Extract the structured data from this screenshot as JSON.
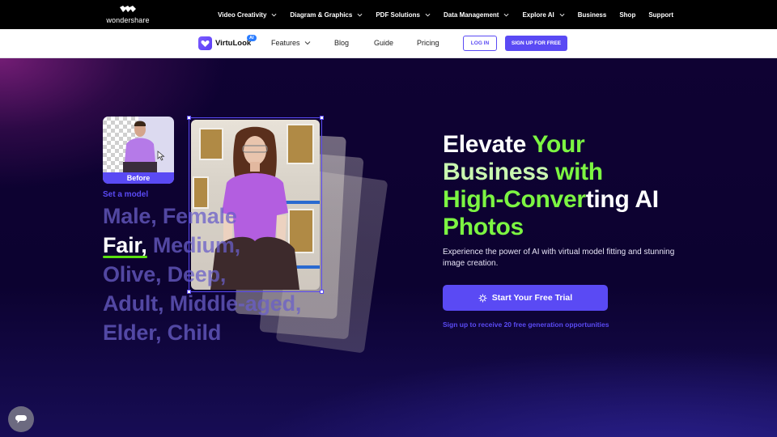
{
  "topbar": {
    "brand": "wondershare",
    "nav": [
      {
        "label": "Video Creativity",
        "has_dropdown": true
      },
      {
        "label": "Diagram & Graphics",
        "has_dropdown": true
      },
      {
        "label": "PDF Solutions",
        "has_dropdown": true
      },
      {
        "label": "Data Management",
        "has_dropdown": true
      },
      {
        "label": "Explore AI",
        "has_dropdown": true
      },
      {
        "label": "Business",
        "has_dropdown": false
      },
      {
        "label": "Shop",
        "has_dropdown": false
      },
      {
        "label": "Support",
        "has_dropdown": false
      }
    ]
  },
  "product_nav": {
    "product_name": "VirtuLook",
    "badge": "AI",
    "items": [
      {
        "label": "Features",
        "has_dropdown": true
      },
      {
        "label": "Blog"
      },
      {
        "label": "Guide"
      },
      {
        "label": "Pricing"
      }
    ],
    "login_label": "LOG IN",
    "signup_label": "SIGN UP FOR FREE"
  },
  "hero": {
    "before_label": "Before",
    "set_model_label": "Set a model",
    "attribute_lines": [
      {
        "parts": [
          {
            "text": "Male, Female",
            "highlight": false
          }
        ]
      },
      {
        "parts": [
          {
            "text": "Fair,",
            "highlight": true
          },
          {
            "text": " Medium,",
            "highlight": false
          }
        ]
      },
      {
        "parts": [
          {
            "text": "Olive, Deep,",
            "highlight": false
          }
        ]
      },
      {
        "parts": [
          {
            "text": "Adult, Middle-aged,",
            "highlight": false
          }
        ]
      },
      {
        "parts": [
          {
            "text": "Elder, Child",
            "highlight": false
          }
        ]
      }
    ],
    "headline": {
      "line1_a": "Elevate ",
      "line1_b": "Your",
      "line2_a": "Business ",
      "line2_b": "with",
      "line3_a": "High-Conver",
      "line3_b": "ting AI",
      "line4": "Photos"
    },
    "subcopy": "Experience the power of AI with virtual model fitting and stunning image creation.",
    "cta_label": "Start Your Free Trial",
    "cta_note": "Sign up to receive 20 free generation opportunities"
  },
  "colors": {
    "accent": "#5a4af4",
    "highlight_green": "#7cf542",
    "background": "#0d0230"
  },
  "icons": {
    "chat": "chat-bubble-icon",
    "cta": "sparkle-gear-icon",
    "dropdown": "chevron-down-icon"
  }
}
